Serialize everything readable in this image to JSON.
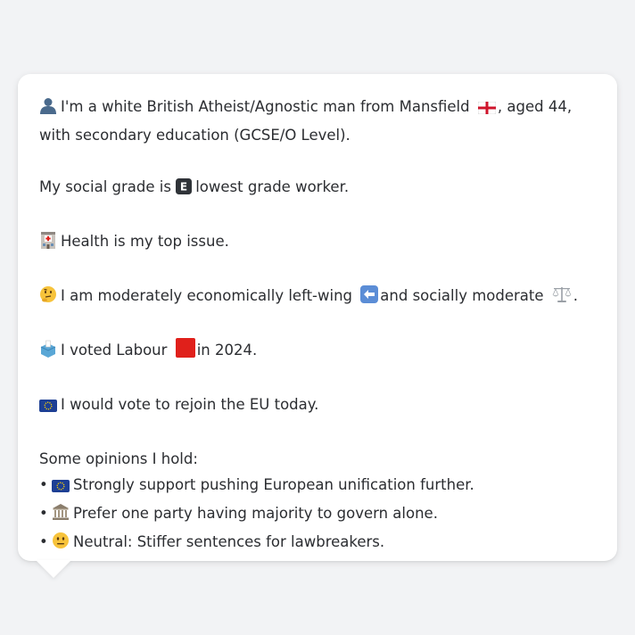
{
  "persona": {
    "intro_text": "I'm a white British Atheist/Agnostic man from Mansfield",
    "intro_text_2": ", aged 44, with secondary education (GCSE/O Level).",
    "grade_prefix": "My social grade is",
    "grade_suffix": "lowest grade worker.",
    "grade_letter": "E",
    "top_issue": "Health is my top issue.",
    "economic_prefix": "I am moderately economically left-wing",
    "economic_mid": "and socially moderate",
    "economic_end": ".",
    "vote_prefix": "I voted Labour",
    "vote_suffix": "in 2024.",
    "eu_text": "I would vote to rejoin the EU today.",
    "opinions_heading": "Some opinions I hold:",
    "opinions": [
      {
        "bullet": "•",
        "icon": "eu-flag-icon",
        "text": "Strongly support pushing European unification further."
      },
      {
        "bullet": "•",
        "icon": "classical-building-icon",
        "text": "Prefer one party having majority to govern alone."
      },
      {
        "bullet": "•",
        "icon": "neutral-face-icon",
        "text": "Neutral: Stiffer sentences for lawbreakers."
      }
    ]
  },
  "colors": {
    "background": "#f2f3f5",
    "bubble": "#ffffff",
    "text": "#2b2d31",
    "labour_red": "#e0201b",
    "eu_blue": "#1d3f94",
    "eu_yellow": "#ffd400"
  }
}
